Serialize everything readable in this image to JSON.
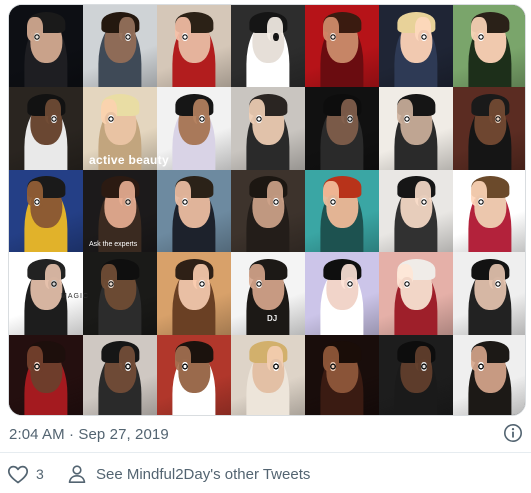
{
  "tweet": {
    "media_alt": "Collage of celebrities making the hand-over-eye circle gesture",
    "collage_text": {
      "magazine_title": "active beauty",
      "magazine_sub": "Ask the experts",
      "magic_word": "MAGIC",
      "dj_tag": "DJ"
    },
    "timestamp": "2:04 AM · Sep 27, 2019",
    "like_count": "3",
    "other_tweets_label": "See Mindful2Day's other Tweets"
  },
  "icons": {
    "info": "info-circle-icon",
    "like": "heart-outline-icon",
    "profile": "person-outline-icon"
  },
  "colors": {
    "secondary_text": "#536471",
    "divider": "#e6ecf0",
    "media_border": "#d9dde0"
  },
  "collage": {
    "rows": 5,
    "cols": 7,
    "tiles": [
      {
        "bg": "#0d0f14",
        "skin": "#c9a28a",
        "hair": "#1a1a1a",
        "cloth": "#1e1e22",
        "ring": "#e7e3dc"
      },
      {
        "bg": "#cfd3d6",
        "skin": "#8e6b57",
        "hair": "#24180f",
        "cloth": "#3f4a57",
        "ring": "#f2f2f2"
      },
      {
        "bg": "#d5c7b8",
        "skin": "#e5b39c",
        "hair": "#2b2116",
        "cloth": "#b21d1e",
        "ring": "#fff"
      },
      {
        "bg": "#2d2d2d",
        "skin": "#e6dfd8",
        "hair": "#151515",
        "cloth": "#ffffff",
        "ring": "#111"
      },
      {
        "bg": "#b61318",
        "skin": "#c68566",
        "hair": "#3a1b10",
        "cloth": "#6a0c10",
        "ring": "#f7e8df"
      },
      {
        "bg": "#1f2535",
        "skin": "#f1c9b0",
        "hair": "#e8d299",
        "cloth": "#2e3a55",
        "ring": "#fff"
      },
      {
        "bg": "#7aa56b",
        "skin": "#f0c9ae",
        "hair": "#2a2118",
        "cloth": "#1d2f1a",
        "ring": "#fff"
      },
      {
        "bg": "#2a2520",
        "skin": "#6a4732",
        "hair": "#121212",
        "cloth": "#e9e9e9",
        "ring": "#f4f4f4"
      },
      {
        "bg": "#e4d6bf",
        "skin": "#e9c3a3",
        "hair": "#e9dda4",
        "cloth": "#c2a57e",
        "ring": "#fff"
      },
      {
        "bg": "#f2f2f2",
        "skin": "#a9795a",
        "hair": "#161616",
        "cloth": "#d9d3e6",
        "ring": "#fff"
      },
      {
        "bg": "#c9c5c0",
        "skin": "#e1c2aa",
        "hair": "#2a2522",
        "cloth": "#2a2a2a",
        "ring": "#fff"
      },
      {
        "bg": "#111111",
        "skin": "#7a5a48",
        "hair": "#0d0d0d",
        "cloth": "#2a2a2a",
        "ring": "#ddd"
      },
      {
        "bg": "#f0ece6",
        "skin": "#bfa592",
        "hair": "#151515",
        "cloth": "#2a2a2a",
        "ring": "#fff"
      },
      {
        "bg": "#5b2c22",
        "skin": "#6e4630",
        "hair": "#1a1a1a",
        "cloth": "#151515",
        "ring": "#e9d3c2"
      },
      {
        "bg": "#243f86",
        "skin": "#8d5b33",
        "hair": "#1a1a1a",
        "cloth": "#e1b22a",
        "ring": "#fff"
      },
      {
        "bg": "#1c1a1b",
        "skin": "#d9a389",
        "hair": "#2b1a12",
        "cloth": "#3a2a20",
        "ring": "#e6d7cc"
      },
      {
        "bg": "#6d8aa0",
        "skin": "#e0b49a",
        "hair": "#2b2218",
        "cloth": "#1d222c",
        "ring": "#fff"
      },
      {
        "bg": "#3d332c",
        "skin": "#c09880",
        "hair": "#1c1712",
        "cloth": "#231d19",
        "ring": "#fff"
      },
      {
        "bg": "#3aa6a4",
        "skin": "#e3b494",
        "hair": "#b8331a",
        "cloth": "#1d5250",
        "ring": "#fff"
      },
      {
        "bg": "#e9e7e4",
        "skin": "#e7cdbb",
        "hair": "#161616",
        "cloth": "#313131",
        "ring": "#fff"
      },
      {
        "bg": "#ffffff",
        "skin": "#ecc7ad",
        "hair": "#6b4a2b",
        "cloth": "#b3223b",
        "ring": "#fff"
      },
      {
        "bg": "#ffffff",
        "skin": "#d6b4a0",
        "hair": "#222",
        "cloth": "#1d1d1d",
        "ring": "#ccc"
      },
      {
        "bg": "#1a1a18",
        "skin": "#6b4a33",
        "hair": "#0f0f0f",
        "cloth": "#2c2c2c",
        "ring": "#e7d8cc"
      },
      {
        "bg": "#d8a16a",
        "skin": "#e9bfa4",
        "hair": "#2e2016",
        "cloth": "#6a4024",
        "ring": "#fff"
      },
      {
        "bg": "#f4f4f4",
        "skin": "#c79a82",
        "hair": "#1c1916",
        "cloth": "#1c1916",
        "ring": "#fff"
      },
      {
        "bg": "#ccc5e9",
        "skin": "#f1d4c9",
        "hair": "#0f0f0f",
        "cloth": "#ffffff",
        "ring": "#fff"
      },
      {
        "bg": "#e5b0a8",
        "skin": "#f2d6c7",
        "hair": "#f0ece8",
        "cloth": "#9e1f2a",
        "ring": "#fff"
      },
      {
        "bg": "#efefef",
        "skin": "#d6b7a4",
        "hair": "#121212",
        "cloth": "#222",
        "ring": "#fff"
      },
      {
        "bg": "#240f0f",
        "skin": "#6e3d2b",
        "hair": "#1d0f0c",
        "cloth": "#a41a1f",
        "ring": "#f4d9cc"
      },
      {
        "bg": "#cfc8c2",
        "skin": "#6e4a36",
        "hair": "#161616",
        "cloth": "#2a2a2a",
        "ring": "#eee"
      },
      {
        "bg": "#b1372b",
        "skin": "#9a6a4c",
        "hair": "#1b120d",
        "cloth": "#ffffff",
        "ring": "#fff"
      },
      {
        "bg": "#ded4c8",
        "skin": "#e3c0a5",
        "hair": "#d2b06c",
        "cloth": "#ede5da",
        "ring": "#fff"
      },
      {
        "bg": "#190d0b",
        "skin": "#8a5438",
        "hair": "#1a0d08",
        "cloth": "#3a1b12",
        "ring": "#e9c8b2"
      },
      {
        "bg": "#1d1d1d",
        "skin": "#5d3c2b",
        "hair": "#0d0d0d",
        "cloth": "#1a1a1a",
        "ring": "#ddd"
      },
      {
        "bg": "#efefef",
        "skin": "#c79a82",
        "hair": "#1c1916",
        "cloth": "#1c1916",
        "ring": "#fff"
      }
    ]
  }
}
